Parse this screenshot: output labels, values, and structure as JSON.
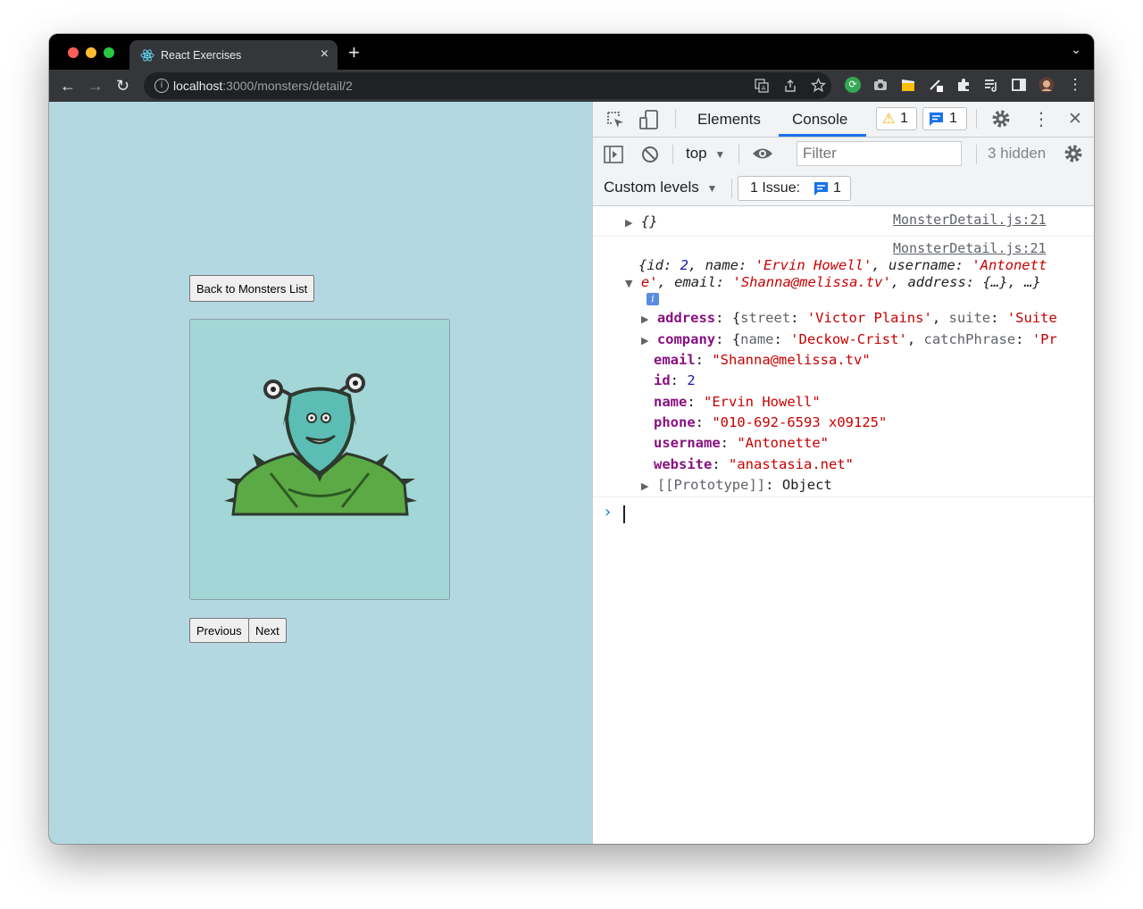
{
  "browser": {
    "tab_title": "React Exercises",
    "close_glyph": "×",
    "new_tab_glyph": "+",
    "tab_menu_glyph": "⌄",
    "url_host": "localhost",
    "url_path": ":3000/monsters/detail/2",
    "back_glyph": "←",
    "forward_glyph": "→",
    "reload_glyph": "↻",
    "menu_glyph": "⋮"
  },
  "page": {
    "back_button": "Back to Monsters List",
    "previous_button": "Previous",
    "next_button": "Next",
    "background_color": "#b4d8e2"
  },
  "devtools": {
    "tabs": [
      "Elements",
      "Console"
    ],
    "active_tab": "Console",
    "warning_count": "1",
    "message_count": "1",
    "context": "top",
    "filter_placeholder": "Filter",
    "hidden_count": "3 hidden",
    "levels": "Custom levels",
    "issues_label": "1 Issue:",
    "issues_count": "1",
    "close_glyph": "✕",
    "kebab_glyph": "⋮"
  },
  "console": {
    "entry1": {
      "source": "MonsterDetail.js:21",
      "preview": "{}"
    },
    "entry2": {
      "source": "MonsterDetail.js:21",
      "preview_line1_parts": [
        "{id: ",
        "2",
        ", name: ",
        "'Ervin Howell'",
        ", username: ",
        "'Antonett"
      ],
      "preview_line2_parts": [
        "e'",
        ", email: ",
        "'Shanna@melissa.tv'",
        ", address: {…}, …}"
      ],
      "info_badge": "i",
      "props": [
        {
          "key": "address",
          "value": "{street: 'Victor Plains', suite: 'Suite",
          "expandable": true,
          "kind": "object"
        },
        {
          "key": "company",
          "value": "{name: 'Deckow-Crist', catchPhrase: 'Pr",
          "expandable": true,
          "kind": "object"
        },
        {
          "key": "email",
          "value": "\"Shanna@melissa.tv\"",
          "kind": "string"
        },
        {
          "key": "id",
          "value": "2",
          "kind": "number"
        },
        {
          "key": "name",
          "value": "\"Ervin Howell\"",
          "kind": "string"
        },
        {
          "key": "phone",
          "value": "\"010-692-6593 x09125\"",
          "kind": "string"
        },
        {
          "key": "username",
          "value": "\"Antonette\"",
          "kind": "string"
        },
        {
          "key": "website",
          "value": "\"anastasia.net\"",
          "kind": "string"
        }
      ],
      "prototype_key": "[[Prototype]]",
      "prototype_value": "Object"
    },
    "prompt_glyph": "›"
  },
  "colors": {
    "devtools_accent": "#1a73e8",
    "console_key": "#881280",
    "console_string": "#c80000",
    "console_number": "#1a1aa6"
  }
}
